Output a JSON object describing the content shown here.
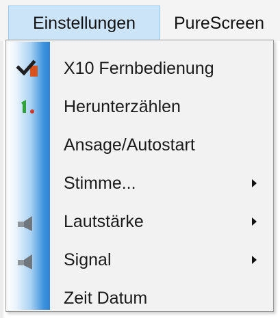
{
  "menubar": {
    "open_menu_label": "Einstellungen",
    "next_menu_label": "PureScreen"
  },
  "dropdown": {
    "items": [
      {
        "label": "X10 Fernbedienung",
        "icon": "checkmark-icon",
        "submenu": false
      },
      {
        "label": "Herunterzählen",
        "icon": "countdown-icon",
        "submenu": false
      },
      {
        "label": "Ansage/Autostart",
        "icon": "",
        "submenu": false
      },
      {
        "label": "Stimme...",
        "icon": "",
        "submenu": true
      },
      {
        "label": "Lautstärke",
        "icon": "speaker-icon",
        "submenu": true
      },
      {
        "label": "Signal",
        "icon": "speaker-icon",
        "submenu": true
      },
      {
        "label": "Zeit Datum",
        "icon": "",
        "submenu": false
      }
    ]
  },
  "colors": {
    "menubar_highlight": "#cce4f7",
    "icon_column_blue": "#2f84d3"
  }
}
